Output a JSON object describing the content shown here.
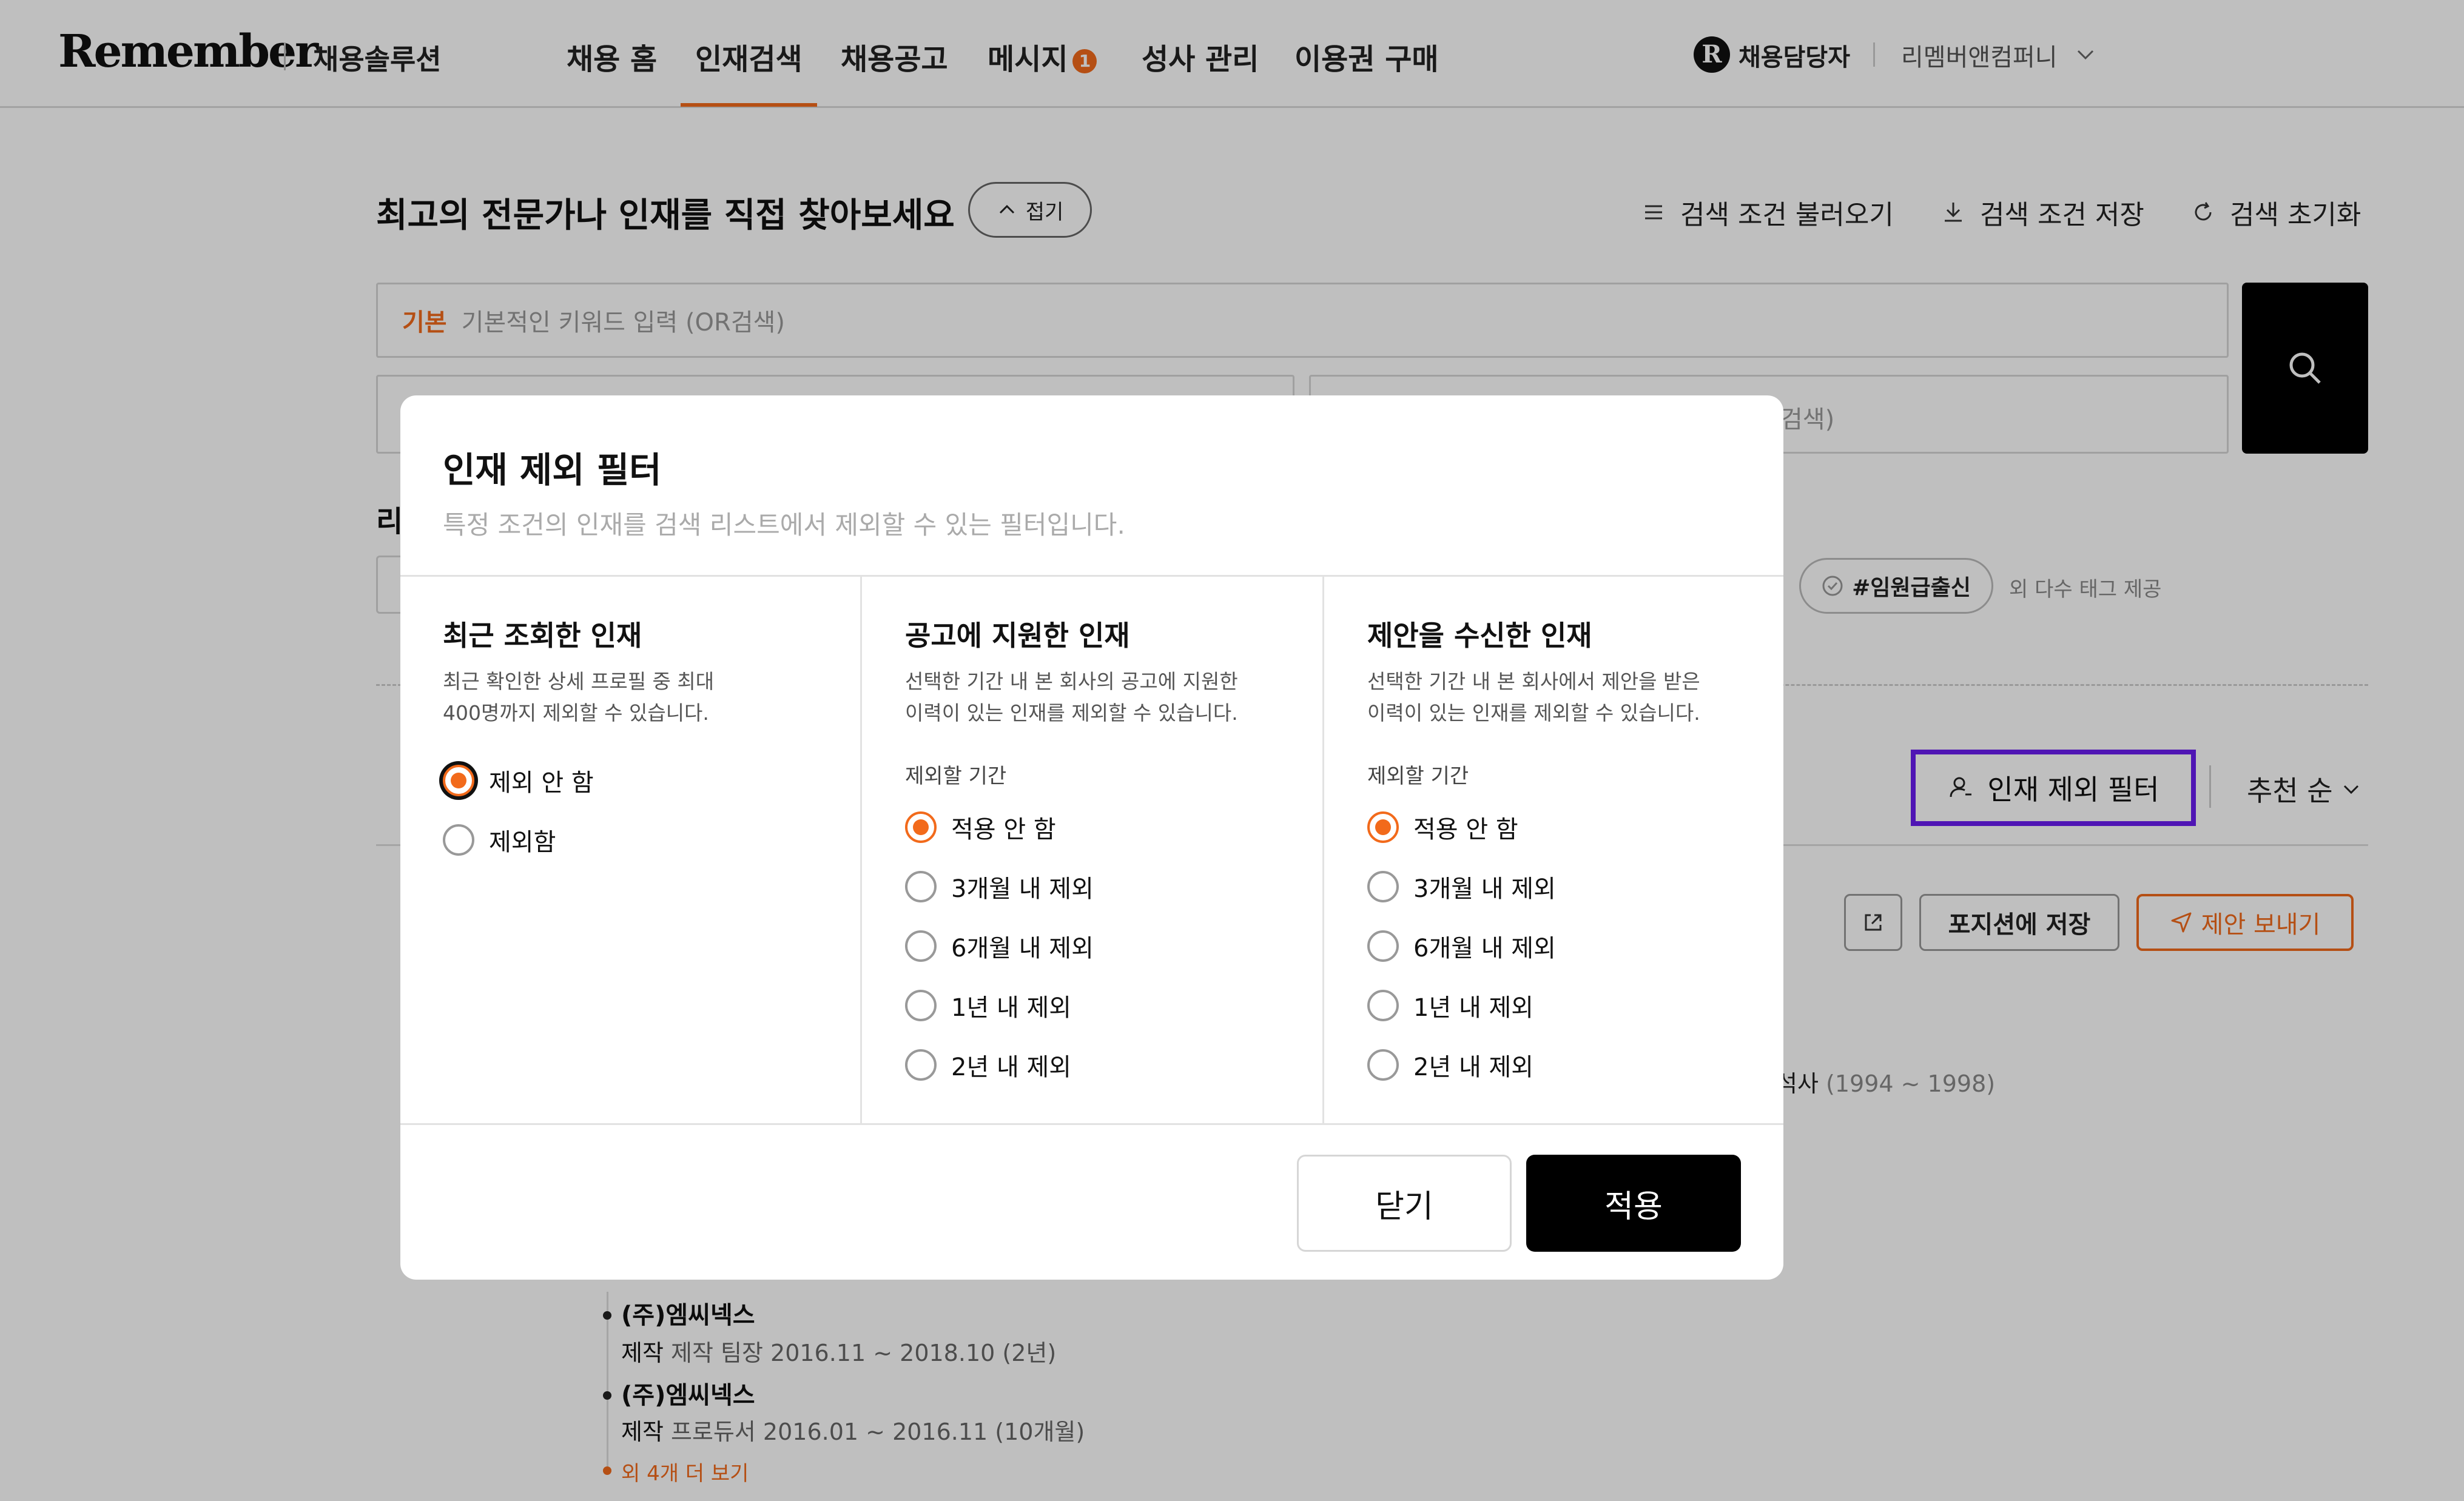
{
  "nav": {
    "logo": "Remember",
    "logo_sub": "채용솔루션",
    "items": [
      {
        "label": "채용 홈"
      },
      {
        "label": "인재검색"
      },
      {
        "label": "채용공고"
      },
      {
        "label": "메시지",
        "badge": "1"
      },
      {
        "label": "성사 관리"
      },
      {
        "label": "이용권 구매"
      }
    ],
    "user_logo": "R",
    "user_role": "채용담당자",
    "company": "리멤버앤컴퍼니"
  },
  "page": {
    "title": "최고의 전문가나 인재를 직접 찾아보세요",
    "collapse_label": "접기",
    "actions": {
      "load": "검색 조건 불러오기",
      "save": "검색 조건 저장",
      "reset": "검색 초기화"
    },
    "keyword": {
      "label": "기본",
      "placeholder": "기본적인 키워드 입력 (OR검색)",
      "second_placeholder_tail": "검색)"
    },
    "section_label_partial": "리",
    "tag_chip": "#임원급출신",
    "tag_more": "외 다수 태그 제공",
    "filter_button": "인재 제외 필터",
    "sort_label": "추천 순",
    "save_position": "포지션에 저장",
    "send_offer": "제안 보내기",
    "education_partial": "석사",
    "education_dates": "(1994 ~ 1998)",
    "careers": [
      {
        "company": "(주)엠씨넥스",
        "dept": "제작",
        "detail": "제작 팀장 2016.11 ~ 2018.10 (2년)"
      },
      {
        "company": "(주)엠씨넥스",
        "dept": "제작",
        "detail": "프로듀서 2016.01 ~ 2016.11 (10개월)"
      }
    ],
    "more_link": "외 4개 더 보기"
  },
  "modal": {
    "title": "인재 제외 필터",
    "description": "특정 조건의 인재를 검색 리스트에서 제외할 수 있는 필터입니다.",
    "columns": [
      {
        "title": "최근 조회한 인재",
        "desc_line1": "최근 확인한 상세 프로필 중 최대",
        "desc_line2": "400명까지 제외할 수 있습니다.",
        "options": [
          "제외 안 함",
          "제외함"
        ],
        "selected": 0
      },
      {
        "title": "공고에 지원한 인재",
        "desc_line1": "선택한 기간 내 본 회사의 공고에 지원한",
        "desc_line2": "이력이 있는 인재를 제외할 수 있습니다.",
        "period_label": "제외할 기간",
        "options": [
          "적용 안 함",
          "3개월 내 제외",
          "6개월 내 제외",
          "1년 내 제외",
          "2년 내 제외"
        ],
        "selected": 0
      },
      {
        "title": "제안을 수신한 인재",
        "desc_line1": "선택한 기간 내 본 회사에서 제안을 받은",
        "desc_line2": "이력이 있는 인재를 제외할 수 있습니다.",
        "period_label": "제외할 기간",
        "options": [
          "적용 안 함",
          "3개월 내 제외",
          "6개월 내 제외",
          "1년 내 제외",
          "2년 내 제외"
        ],
        "selected": 0
      }
    ],
    "close_label": "닫기",
    "apply_label": "적용"
  },
  "colors": {
    "accent": "#f26a1b",
    "focus_outline": "#6a1cf0",
    "primary_button": "#000000"
  }
}
